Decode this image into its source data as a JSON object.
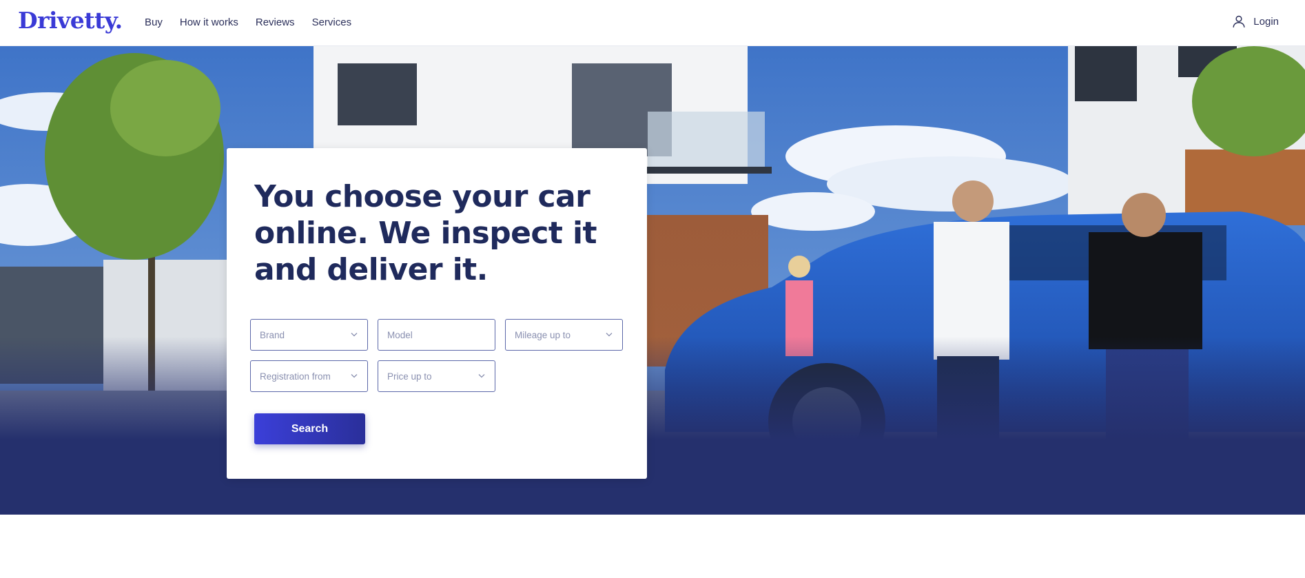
{
  "brand": {
    "logo_text": "Drivetty",
    "logo_dot": ".",
    "accent_color": "#3a3ad6",
    "navy_color": "#1f2a5c"
  },
  "nav": {
    "items": [
      {
        "label": "Buy"
      },
      {
        "label": "How it works"
      },
      {
        "label": "Reviews"
      },
      {
        "label": "Services"
      }
    ]
  },
  "login": {
    "label": "Login",
    "icon": "user-icon"
  },
  "hero": {
    "headline": "You choose your car online. We inspect it and deliver it.",
    "filters": {
      "brand": {
        "placeholder": "Brand",
        "icon": "chevron-down-icon"
      },
      "model": {
        "placeholder": "Model"
      },
      "mileage": {
        "placeholder": "Mileage up to",
        "icon": "chevron-down-icon"
      },
      "registration": {
        "placeholder": "Registration from",
        "icon": "chevron-down-icon"
      },
      "price": {
        "placeholder": "Price up to",
        "icon": "chevron-down-icon"
      }
    },
    "search_label": "Search"
  }
}
